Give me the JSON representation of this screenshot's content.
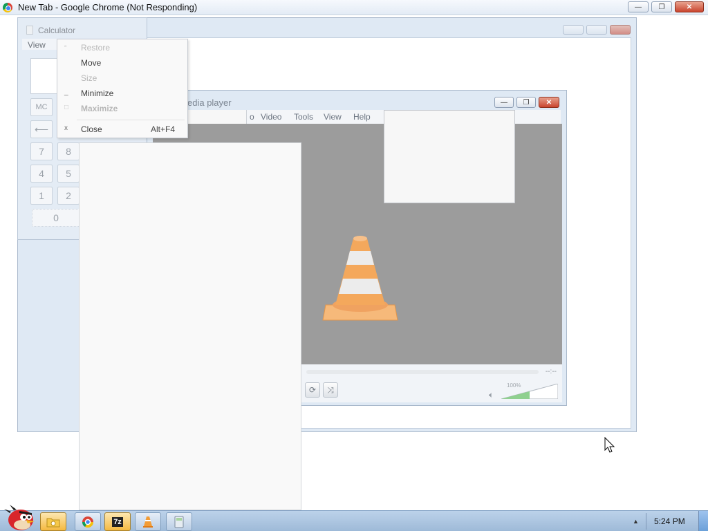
{
  "chrome": {
    "title": "New Tab - Google Chrome (Not Responding)",
    "minimize": "—",
    "restore": "❐",
    "close": "✕"
  },
  "calculator": {
    "title": "Calculator",
    "menu_view": "View",
    "keys": {
      "mc": "MC",
      "backspace": "⟵",
      "k7": "7",
      "k8": "8",
      "k4": "4",
      "k5": "5",
      "k1": "1",
      "k2": "2",
      "k0": "0"
    }
  },
  "system_menu": {
    "items": [
      {
        "label": "Restore",
        "glyph": "▫",
        "enabled": false
      },
      {
        "label": "Move",
        "glyph": "",
        "enabled": true
      },
      {
        "label": "Size",
        "glyph": "",
        "enabled": false
      },
      {
        "label": "Minimize",
        "glyph": "_",
        "enabled": true
      },
      {
        "label": "Maximize",
        "glyph": "□",
        "enabled": false
      },
      {
        "label": "Close",
        "glyph": "x",
        "enabled": true,
        "shortcut": "Alt+F4"
      }
    ]
  },
  "vlc": {
    "title": "edia player",
    "menu": [
      "o",
      "Video",
      "Tools",
      "View",
      "Help"
    ],
    "time": "--:--",
    "volume_pct": "100%",
    "volume_level": 0.5,
    "buttons": {
      "loop": "⟳",
      "shuffle": "⤨"
    },
    "volume_icon": "speaker-icon"
  },
  "taskbar": {
    "clock": "5:24 PM",
    "tray_arrow": "▲",
    "items": [
      "folder-icon",
      "chrome-icon",
      "7zip-icon",
      "vlc-icon",
      "calculator-icon"
    ],
    "zip_label": "7z"
  },
  "colors": {
    "vlc_video_bg": "#9c9c9c",
    "cone_orange": "#f4a85c"
  }
}
